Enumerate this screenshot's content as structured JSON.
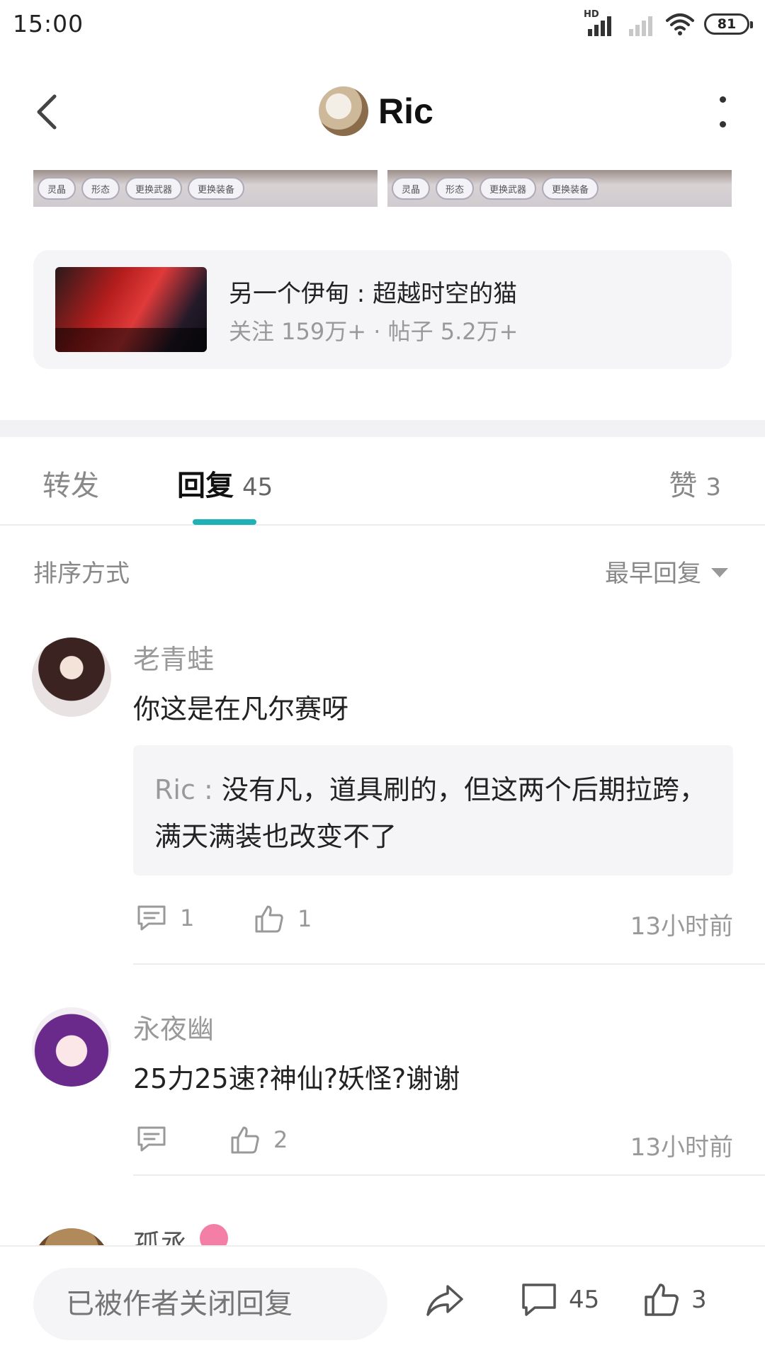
{
  "status_bar": {
    "time": "15:00",
    "signal_label": "HD",
    "battery": "81"
  },
  "header": {
    "title": "Ric"
  },
  "image_strip": [
    {
      "pills": [
        "灵晶",
        "形态",
        "更换武器",
        "更换装备"
      ]
    },
    {
      "pills": [
        "灵晶",
        "形态",
        "更换武器",
        "更换装备"
      ]
    }
  ],
  "forum_card": {
    "name": "另一个伊甸 : 超越时空的猫",
    "stats": "关注 159万+ · 帖子 5.2万+"
  },
  "tabs": {
    "forward": "转发",
    "reply": "回复",
    "reply_count": "45",
    "like": "赞",
    "like_count": "3"
  },
  "sort": {
    "label": "排序方式",
    "selected": "最早回复"
  },
  "comments": [
    {
      "name": "老青蛙",
      "text": "你这是在凡尔赛呀",
      "quote_author": "Ric",
      "quote_sep": " : ",
      "quote_text": "没有凡，道具刷的，但这两个后期拉跨，满天满装也改变不了",
      "reply_count": "1",
      "like_count": "1",
      "time": "13小时前"
    },
    {
      "name": "永夜幽",
      "text": "25力25速?神仙?妖怪?谢谢",
      "reply_count": "",
      "like_count": "2",
      "time": "13小时前"
    },
    {
      "name": "孤丞"
    }
  ],
  "bottom_bar": {
    "input_placeholder": "已被作者关闭回复",
    "comment_count": "45",
    "like_count": "3"
  },
  "colors": {
    "accent": "#1fb1b6",
    "muted_text": "#999999",
    "card_bg": "#f5f5f7"
  }
}
